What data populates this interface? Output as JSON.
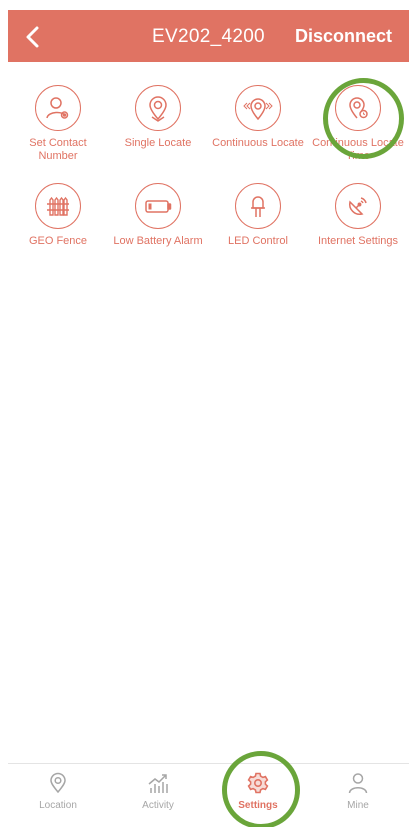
{
  "header": {
    "title": "EV202_4200",
    "disconnect_label": "Disconnect",
    "background": "#e07363"
  },
  "grid": {
    "items": [
      {
        "label": "Set Contact Number",
        "icon": "contact-settings-icon"
      },
      {
        "label": "Single Locate",
        "icon": "location-pin-icon"
      },
      {
        "label": "Continuous Locate",
        "icon": "continuous-locate-icon"
      },
      {
        "label": "Continuous Locate Time",
        "icon": "locate-time-icon"
      },
      {
        "label": "GEO Fence",
        "icon": "fence-icon"
      },
      {
        "label": "Low Battery Alarm",
        "icon": "low-battery-icon"
      },
      {
        "label": "LED Control",
        "icon": "led-icon"
      },
      {
        "label": "Internet Settings",
        "icon": "satellite-dish-icon"
      }
    ]
  },
  "tabs": [
    {
      "label": "Location",
      "icon": "location-icon",
      "active": false
    },
    {
      "label": "Activity",
      "icon": "activity-icon",
      "active": false
    },
    {
      "label": "Settings",
      "icon": "gear-icon",
      "active": true
    },
    {
      "label": "Mine",
      "icon": "user-icon",
      "active": false
    }
  ],
  "colors": {
    "accent": "#e07363",
    "highlight": "#6aa53a",
    "inactive": "#a6a6a6"
  }
}
